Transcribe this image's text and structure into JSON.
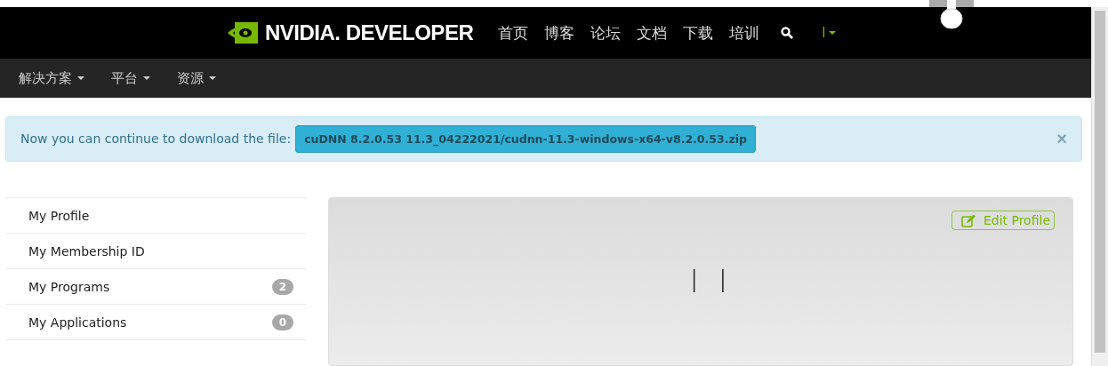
{
  "header": {
    "logo": {
      "brand": "NVIDIA.",
      "product": "DEVELOPER"
    },
    "links": [
      "首页",
      "博客",
      "论坛",
      "文档",
      "下载",
      "培训"
    ],
    "user": "l"
  },
  "subnav": [
    "解决方案",
    "平台",
    "资源"
  ],
  "alert": {
    "message": "Now you can continue to download the file:",
    "file": "cuDNN 8.2.0.53 11.3_04222021/cudnn-11.3-windows-x64-v8.2.0.53.zip",
    "close": "×"
  },
  "sidebar": {
    "items": [
      {
        "label": "My Profile"
      },
      {
        "label": "My Membership ID"
      },
      {
        "label": "My Programs",
        "count": "2"
      },
      {
        "label": "My Applications",
        "count": "0"
      }
    ]
  },
  "profile": {
    "edit": "Edit Profile",
    "name": "l l"
  }
}
